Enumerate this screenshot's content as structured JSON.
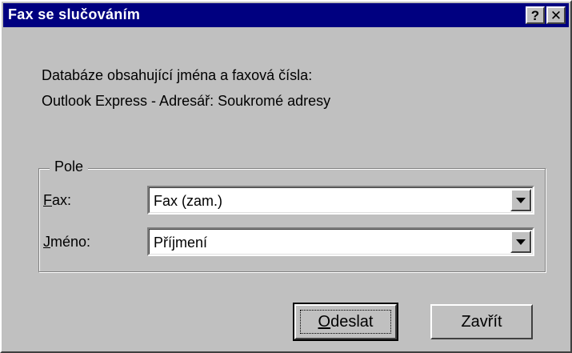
{
  "window": {
    "title": "Fax se slučováním",
    "help_button": "?",
    "close_button": "✕"
  },
  "info": {
    "line1": "Databáze obsahující jména a faxová čísla:",
    "line2": "Outlook Express - Adresář: Soukromé adresy"
  },
  "group": {
    "legend": "Pole",
    "fax": {
      "label_accel": "F",
      "label_rest": "ax:",
      "value": "Fax (zam.)"
    },
    "name": {
      "label_accel": "J",
      "label_rest": "méno:",
      "value": "Příjmení"
    }
  },
  "buttons": {
    "send_accel": "O",
    "send_rest": "deslat",
    "close": "Zavřít"
  }
}
